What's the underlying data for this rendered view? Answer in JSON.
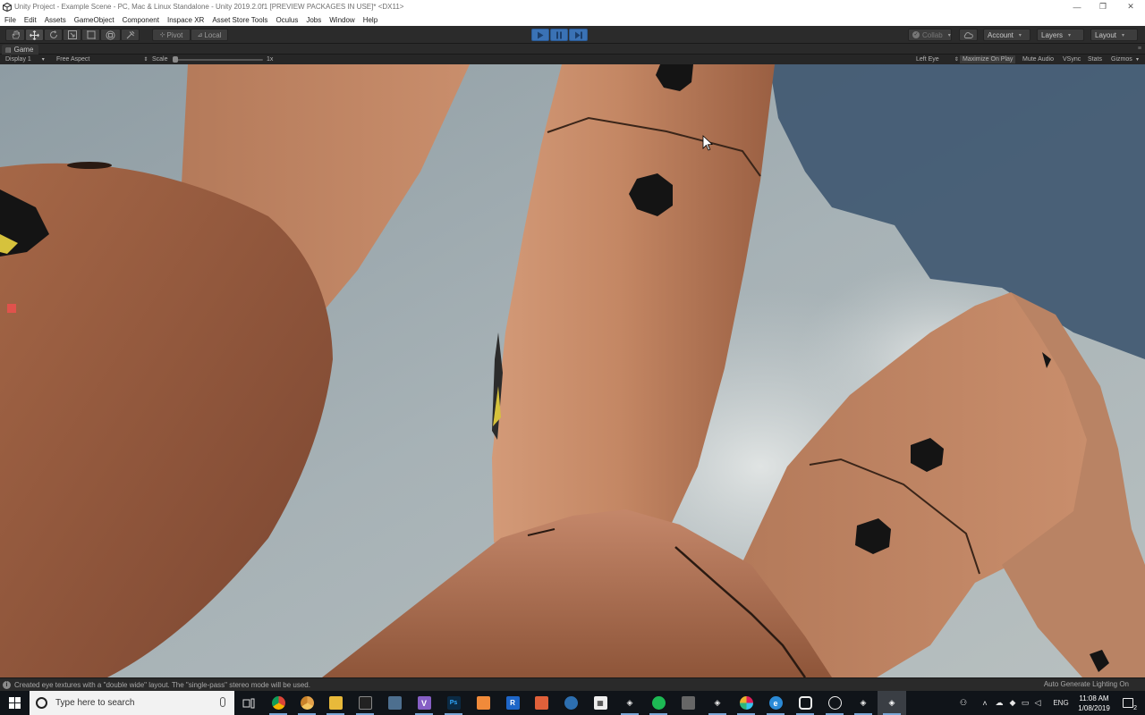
{
  "window": {
    "title": "Unity Project - Example Scene - PC, Mac & Linux Standalone - Unity 2019.2.0f1 [PREVIEW PACKAGES IN USE]* <DX11>",
    "minimize_glyph": "—",
    "maximize_glyph": "❐",
    "close_glyph": "✕"
  },
  "menu": [
    "File",
    "Edit",
    "Assets",
    "GameObject",
    "Component",
    "Inspace XR",
    "Asset Store Tools",
    "Oculus",
    "Jobs",
    "Window",
    "Help"
  ],
  "toolbar": {
    "tools": [
      "hand-icon",
      "move-icon",
      "rotate-icon",
      "scale-icon",
      "rect-icon",
      "transform-icon",
      "custom-tool-icon"
    ],
    "pivot_label": "Pivot",
    "local_label": "Local",
    "play_state": "playing",
    "collab_label": "Collab",
    "account_label": "Account",
    "layers_label": "Layers",
    "layout_label": "Layout"
  },
  "game_tab": {
    "label": "Game",
    "display": "Display 1",
    "aspect": "Free Aspect",
    "scale_label": "Scale",
    "scale_value": "1x",
    "eye": "Left Eye",
    "toggles": {
      "maximize_on_play": "Maximize On Play",
      "mute_audio": "Mute Audio",
      "vsync": "VSync",
      "stats": "Stats",
      "gizmos": "Gizmos"
    },
    "maximize_on_play_on": true
  },
  "status": {
    "message": "Created eye textures with a \"double wide\" layout. The \"single-pass\" stereo mode will be used.",
    "right": "Auto Generate Lighting On"
  },
  "taskbar": {
    "search_placeholder": "Type here to search",
    "apps": [
      "task-view-icon",
      "chrome-icon",
      "chrome-canary-icon",
      "file-explorer-icon",
      "terminal-icon",
      "photos-icon",
      "visual-studio-icon",
      "photoshop-icon",
      "sublime-icon",
      "rider-icon",
      "app-orange-icon",
      "app-blue-icon",
      "calculator-icon",
      "unity-icon",
      "spotify-icon",
      "app-msg-icon",
      "unity-icon-2",
      "slack-icon",
      "edge-icon",
      "oculus-icon",
      "onedrive-photos-icon",
      "unity-icon-3",
      "unity-icon-4"
    ],
    "language": "ENG",
    "time": "11:08 AM",
    "date": "1/08/2019",
    "notification_count": "2"
  },
  "colors": {
    "editor_dark": "#2b2b2b",
    "play_blue": "#3a72b5",
    "skin": "#b9795a",
    "sky": "#9aa6ad",
    "taskbar": "#101419"
  }
}
